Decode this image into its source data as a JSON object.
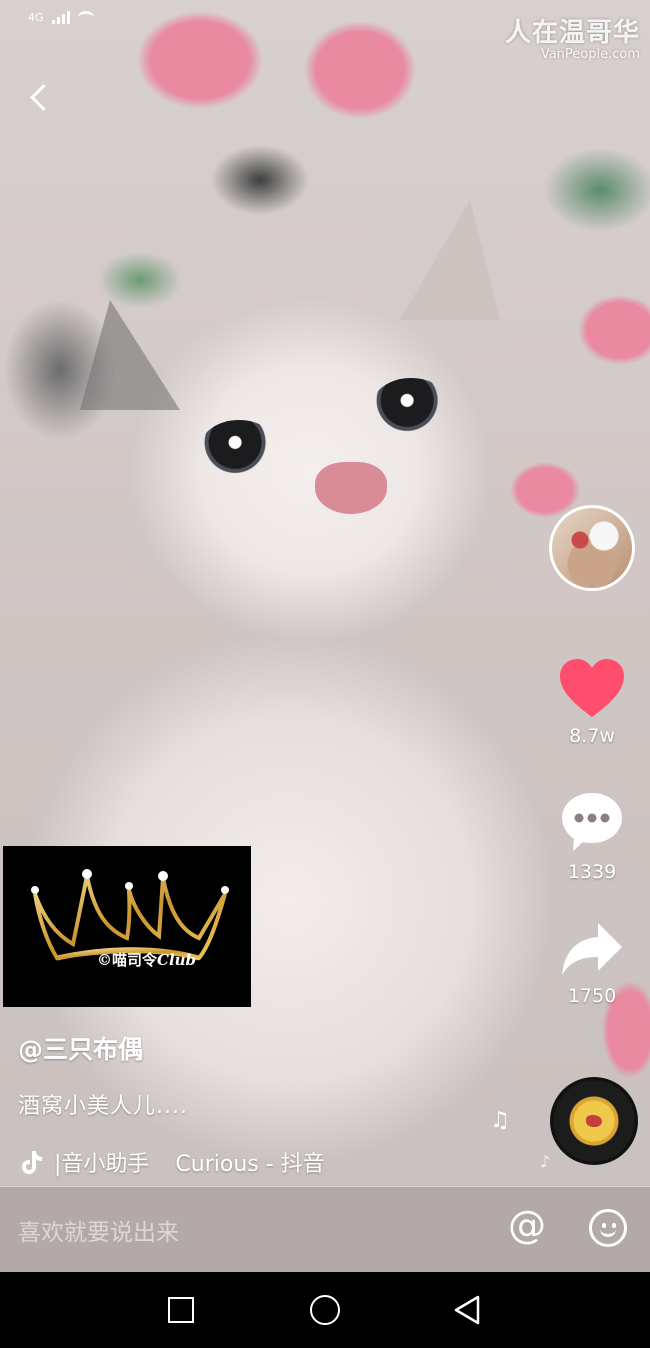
{
  "status_bar": {
    "network": "4G",
    "signal_level": 4
  },
  "watermark": {
    "title": "人在温哥华",
    "subtitle": "VanPeople.com"
  },
  "side_rail": {
    "likes": "8.7w",
    "comments": "1339",
    "shares": "1750",
    "like_color": "#ff4d6d"
  },
  "sticker": {
    "caption_prefix": "©喵司令",
    "caption_suffix": "Club"
  },
  "video_info": {
    "author": "@三只布偶",
    "caption": "酒窝小美人儿....",
    "music_source": "|音小助手",
    "music_title": "Curious - 抖音"
  },
  "comment_bar": {
    "placeholder": "喜欢就要说出来",
    "mention_symbol": "@"
  },
  "icons": {
    "back": "chevron-left-icon",
    "like": "heart-icon",
    "comment": "comment-bubble-icon",
    "share": "share-arrow-icon",
    "music": "tiktok-note-icon",
    "emoji": "smiley-icon"
  }
}
